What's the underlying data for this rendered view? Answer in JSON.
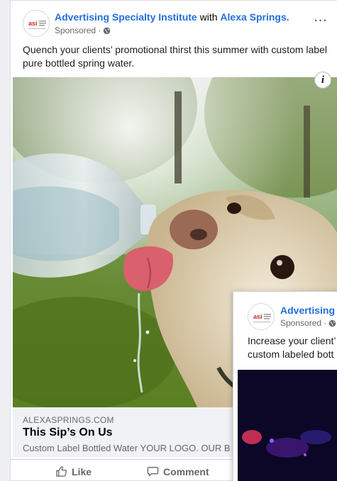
{
  "post": {
    "page_name": "Advertising Specialty Institute",
    "with_word": "with",
    "tagged_page": "Alexa Springs.",
    "sponsored": "Sponsored ·",
    "caption": "Quench your clients’ promotional thirst this summer with custom label pure bottled spring water.",
    "link": {
      "domain": "ALEXASPRINGS.COM",
      "headline": "This Sip’s On Us",
      "description": "Custom Label Bottled Water YOUR LOGO. OUR B"
    },
    "info_glyph": "i",
    "more_glyph": "···"
  },
  "actions": {
    "like": "Like",
    "comment": "Comment"
  },
  "second_post": {
    "page_name": "Advertising S",
    "sponsored": "Sponsored ·",
    "caption_line1": "Increase your client’",
    "caption_line2": "custom labeled bott"
  },
  "avatar_logo_text": "asi",
  "colors": {
    "link_blue": "#216fdb",
    "muted_gray": "#65676b",
    "link_box_bg": "#f0f2f5",
    "logo_red": "#d2232a"
  }
}
